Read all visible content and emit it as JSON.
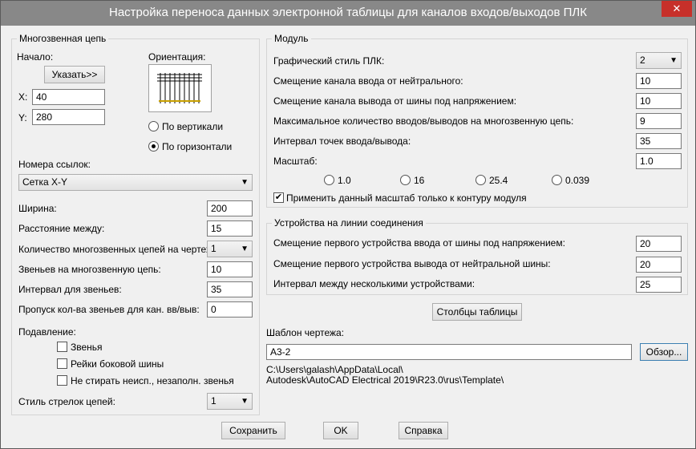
{
  "window": {
    "title": "Настройка переноса данных электронной таблицы для каналов входов/выходов ПЛК",
    "close_glyph": "✕"
  },
  "left": {
    "group_title": "Многозвенная цепь",
    "start_label": "Начало:",
    "pick_button": "Указать>>",
    "x_label": "X:",
    "x_value": "40",
    "y_label": "Y:",
    "y_value": "280",
    "orientation_label": "Ориентация:",
    "radio_vertical": "По вертикали",
    "radio_horizontal": "По горизонтали",
    "orientation_selected": "horizontal",
    "ref_numbers_label": "Номера ссылок:",
    "ref_numbers_value": "Сетка X-Y",
    "width_label": "Ширина:",
    "width_value": "200",
    "spacing_label": "Расстояние между:",
    "spacing_value": "15",
    "ladders_per_drawing_label": "Количество многозвенных цепей на чертеж:",
    "ladders_per_drawing_value": "1",
    "rungs_label": "Звеньев на многозвенную цепь:",
    "rungs_value": "10",
    "rung_interval_label": "Интервал для звеньев:",
    "rung_interval_value": "35",
    "skip_label": "Пропуск кол-ва звеньев для кан. вв/выв:",
    "skip_value": "0",
    "suppress_label": "Подавление:",
    "suppress_rungs": "Звенья",
    "suppress_rails": "Рейки боковой шины",
    "suppress_unused": "Не стирать неисп., незаполн. звенья",
    "arrow_style_label": "Стиль стрелок цепей:",
    "arrow_style_value": "1"
  },
  "module": {
    "group_title": "Модуль",
    "plc_style_label": "Графический стиль ПЛК:",
    "plc_style_value": "2",
    "input_offset_label": "Смещение канала ввода от нейтрального:",
    "input_offset_value": "10",
    "output_offset_label": "Смещение канала вывода от шины под напряжением:",
    "output_offset_value": "10",
    "max_io_label": "Максимальное количество вводов/выводов на многозвенную цепь:",
    "max_io_value": "9",
    "io_interval_label": "Интервал точек ввода/вывода:",
    "io_interval_value": "35",
    "scale_label": "Масштаб:",
    "scale_value": "1.0",
    "scale_options": [
      "1.0",
      "16",
      "25.4",
      "0.039"
    ],
    "apply_scale_label": "Применить данный масштаб только к контуру модуля",
    "apply_scale_checked": true
  },
  "devices": {
    "group_title": "Устройства на линии соединения",
    "first_input_label": "Смещение первого устройства ввода от шины под напряжением:",
    "first_input_value": "20",
    "first_output_label": "Смещение первого устройства вывода от нейтральной шины:",
    "first_output_value": "20",
    "interval_label": "Интервал между несколькими устройствами:",
    "interval_value": "25"
  },
  "columns_button": "Столбцы таблицы",
  "template": {
    "label": "Шаблон чертежа:",
    "value": "A3-2",
    "browse_button": "Обзор...",
    "path_line1": "C:\\Users\\galash\\AppData\\Local\\",
    "path_line2": "Autodesk\\AutoCAD Electrical 2019\\R23.0\\rus\\Template\\"
  },
  "footer": {
    "save": "Сохранить",
    "ok": "OK",
    "help": "Справка"
  },
  "icons": {
    "dropdown": "▼",
    "check": "✔"
  }
}
